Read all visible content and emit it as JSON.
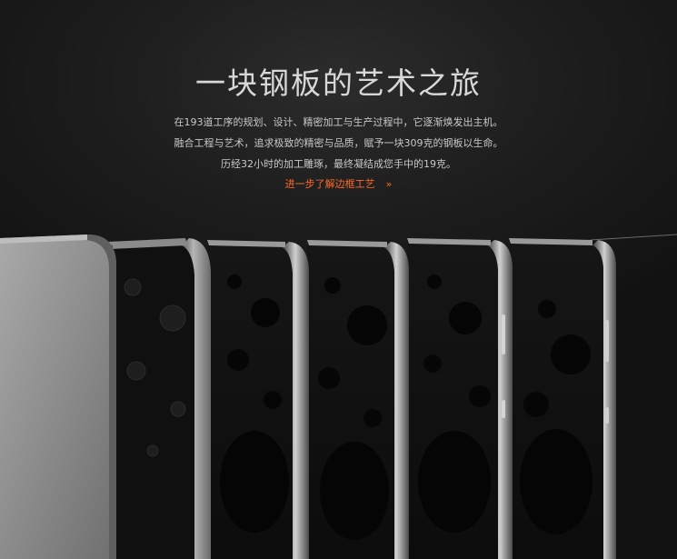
{
  "hero": {
    "title": "一块钢板的艺术之旅",
    "description": [
      "在193道工序的规划、设计、精密加工与生产过程中，它逐渐焕发出主机。",
      "融合工程与艺术，追求极致的精密与品质，赋予一块309克的钢板以生命。",
      "历经32小时的加工雕琢，最终凝结成您手中的19克。"
    ],
    "link_label": "进一步了解边框工艺",
    "link_chevron": "»"
  },
  "colors": {
    "background": "#141414",
    "text": "#c8c8c8",
    "accent": "#ff6a2a",
    "steel": "#8a8a8a"
  },
  "image": {
    "subject": "six phone frames in successive manufacturing stages"
  }
}
